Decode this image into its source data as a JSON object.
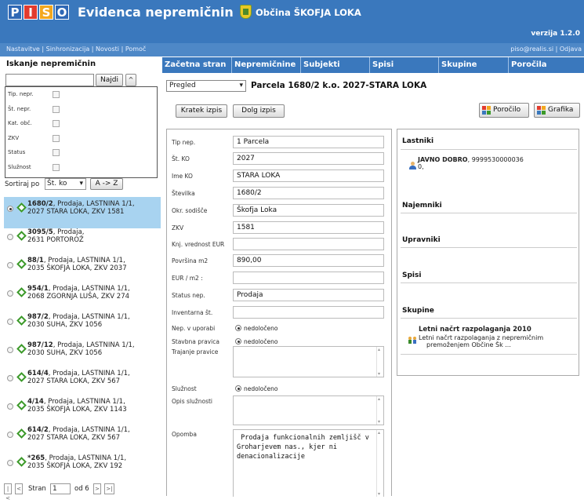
{
  "header": {
    "logo_letters": [
      "P",
      "I",
      "S",
      "O"
    ],
    "app_title": "Evidenca nepremičnin",
    "municipality": "Občina ŠKOFJA LOKA",
    "version": "verzija 1.2.0",
    "sub_links": "Nastavitve | Sinhronizacija | Novosti | Pomoč",
    "user_links": "piso@realis.si  |  Odjava"
  },
  "search": {
    "title": "Iskanje nepremičnin",
    "input_value": "",
    "find_label": "Najdi",
    "up_label": "^",
    "filters": [
      "Tip. nepr.",
      "Št. nepr.",
      "Kat. obč.",
      "ZKV",
      "Status",
      "Služnost"
    ],
    "sort_label": "Sortiraj po",
    "sort_value": "Št. ko",
    "sort_order_label": "A -> Z"
  },
  "results": [
    {
      "id": "1680/2",
      "line1": ", Prodaja, LASTNINA 1/1,",
      "line2": "2027 STARA LOKA, ZKV 1581",
      "selected": true
    },
    {
      "id": "3095/5",
      "line1": ", Prodaja,",
      "line2": "2631 PORTOROŽ",
      "selected": false
    },
    {
      "id": "88/1",
      "line1": ", Prodaja, LASTNINA 1/1,",
      "line2": "2035 ŠKOFJA LOKA, ZKV 2037",
      "selected": false
    },
    {
      "id": "954/1",
      "line1": ", Prodaja, LASTNINA 1/1,",
      "line2": "2068 ZGORNJA LUŠA, ZKV 274",
      "selected": false
    },
    {
      "id": "987/2",
      "line1": ", Prodaja, LASTNINA 1/1,",
      "line2": "2030 SUHA, ZKV 1056",
      "selected": false
    },
    {
      "id": "987/12",
      "line1": ", Prodaja, LASTNINA 1/1,",
      "line2": "2030 SUHA, ZKV 1056",
      "selected": false
    },
    {
      "id": "614/4",
      "line1": ", Prodaja, LASTNINA 1/1,",
      "line2": "2027 STARA LOKA, ZKV 567",
      "selected": false
    },
    {
      "id": "4/14",
      "line1": ", Prodaja, LASTNINA 1/1,",
      "line2": "2035 ŠKOFJA LOKA, ZKV 1143",
      "selected": false
    },
    {
      "id": "614/2",
      "line1": ", Prodaja, LASTNINA 1/1,",
      "line2": "2027 STARA LOKA, ZKV 567",
      "selected": false
    },
    {
      "id": "*265",
      "line1": ", Prodaja, LASTNINA 1/1,",
      "line2": "2035 ŠKOFJA LOKA, ZKV 192",
      "selected": false
    }
  ],
  "pager": {
    "first": "|<",
    "prev": "<",
    "page_label": "Stran",
    "page_value": "1",
    "of_label": "od 6",
    "next": ">",
    "last": ">|"
  },
  "nav": [
    "Začetna stran",
    "Nepremičnine",
    "Subjekti",
    "Spisi",
    "Skupine",
    "Poročila"
  ],
  "main": {
    "view_select": "Pregled",
    "parcel_title": "Parcela 1680/2 k.o. 2027-STARA LOKA",
    "short_btn": "Kratek izpis",
    "long_btn": "Dolg izpis",
    "report_btn": "Poročilo",
    "graphic_btn": "Grafika"
  },
  "form": {
    "tip_nep": {
      "label": "Tip nep.",
      "value": "1  Parcela"
    },
    "st_ko": {
      "label": "Št. KO",
      "value": "2027"
    },
    "ime_ko": {
      "label": "Ime KO",
      "value": "STARA LOKA"
    },
    "stevilka": {
      "label": "Številka",
      "value": "1680/2"
    },
    "sodisce": {
      "label": "Okr. sodišče",
      "value": "Škofja Loka"
    },
    "zkv": {
      "label": "ZKV",
      "value": "1581"
    },
    "knj_vrednost": {
      "label": "Knj. vrednost EUR",
      "value": ""
    },
    "povrsina": {
      "label": "Površina m2",
      "value": "890,00"
    },
    "eur_m2": {
      "label": "EUR / m2 :",
      "value": ""
    },
    "status": {
      "label": "Status nep.",
      "value": "Prodaja"
    },
    "inventarna": {
      "label": "Inventarna št.",
      "value": ""
    },
    "v_uporabi": {
      "label": "Nep. v uporabi",
      "value": "nedoločeno"
    },
    "stavbna_pravica": {
      "label": "Stavbna pravica",
      "value": "nedoločeno"
    },
    "trajanje": {
      "label": "Trajanje pravice",
      "value": ""
    },
    "sluznost": {
      "label": "Služnost",
      "value": "nedoločeno"
    },
    "opis_sluznosti": {
      "label": "Opis služnosti",
      "value": ""
    },
    "opomba": {
      "label": "Opomba",
      "value": " Prodaja funkcionalnih zemljišč v Groharjevem nas., kjer ni denacionalizacije"
    }
  },
  "side": {
    "owners_title": "Lastniki",
    "owner_name": "JAVNO DOBRO",
    "owner_detail": ", 9999530000036",
    "owner_share": "0,",
    "tenants_title": "Najemniki",
    "managers_title": "Upravniki",
    "files_title": "Spisi",
    "groups_title": "Skupine",
    "group_name": "Letni načrt razpolaganja 2010",
    "group_desc1": "Letni načrt razpolaganja z nepremičnim",
    "group_desc2": "premoženjem Občine Šk ..."
  },
  "colors": {
    "header_blue": "#3a78bd",
    "selected_row": "#a8d3f0",
    "logo_red": "#e23b2e",
    "logo_orange": "#f3a71e"
  }
}
